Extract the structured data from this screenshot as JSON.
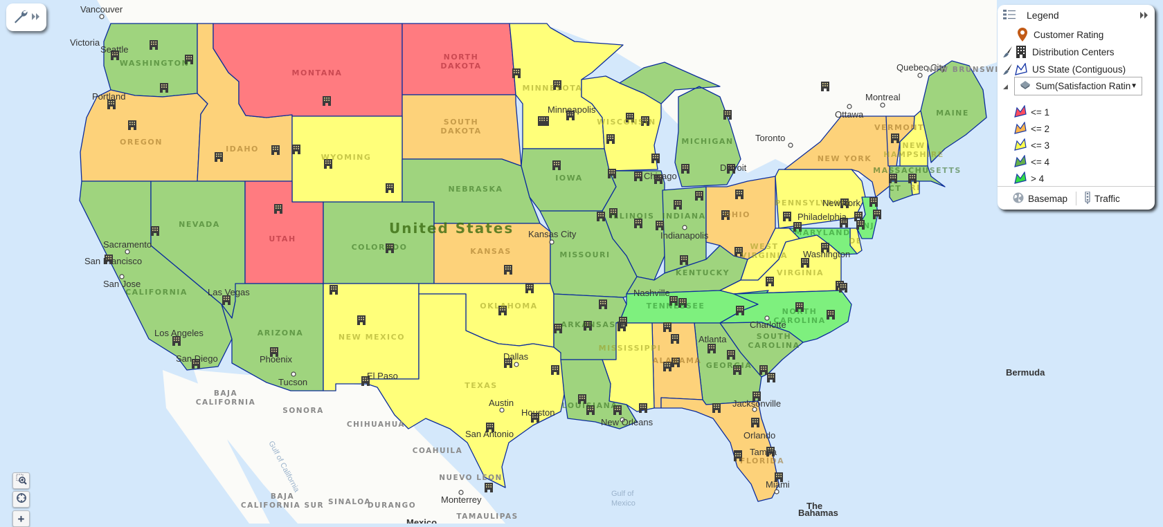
{
  "app": {
    "tool_button_label": "Tools"
  },
  "legend": {
    "title": "Legend",
    "collapse_icon": "double-chevron-right-icon",
    "layers": [
      {
        "name": "Customer Rating",
        "icon": "map-pin-icon",
        "editable": false
      },
      {
        "name": "Distribution Centers",
        "icon": "building-icon",
        "editable": true
      },
      {
        "name": "US State (Contiguous)",
        "icon": "polygon-icon",
        "editable": true
      }
    ],
    "theme_field": "Sum(Satisfaction Ratin",
    "classes": [
      {
        "label": "<= 1",
        "color": "#ff4d5e"
      },
      {
        "label": "<= 2",
        "color": "#ffb54a"
      },
      {
        "label": "<= 3",
        "color": "#ffff4d"
      },
      {
        "label": "<= 4",
        "color": "#66b04a"
      },
      {
        "label": "> 4",
        "color": "#33dd44"
      }
    ],
    "footer": {
      "basemap": "Basemap",
      "traffic": "Traffic"
    }
  },
  "map": {
    "country_label": "United States",
    "class_colors": {
      "c1": "#ff7b80",
      "c2": "#fdd27a",
      "c3": "#ffff7a",
      "c4": "#9fd47e",
      "c5": "#7ef07e"
    },
    "states": [
      {
        "name": "WASHINGTON",
        "class": "c4"
      },
      {
        "name": "OREGON",
        "class": "c2"
      },
      {
        "name": "IDAHO",
        "class": "c2"
      },
      {
        "name": "MONTANA",
        "class": "c1"
      },
      {
        "name": "NORTH DAKOTA",
        "class": "c1"
      },
      {
        "name": "SOUTH DAKOTA",
        "class": "c2"
      },
      {
        "name": "WYOMING",
        "class": "c3"
      },
      {
        "name": "MINNESOTA",
        "class": "c3"
      },
      {
        "name": "WISCONSIN",
        "class": "c3"
      },
      {
        "name": "MICHIGAN",
        "class": "c4"
      },
      {
        "name": "CALIFORNIA",
        "class": "c4"
      },
      {
        "name": "NEVADA",
        "class": "c4"
      },
      {
        "name": "UTAH",
        "class": "c1"
      },
      {
        "name": "COLORADO",
        "class": "c4"
      },
      {
        "name": "NEBRASKA",
        "class": "c4"
      },
      {
        "name": "IOWA",
        "class": "c4"
      },
      {
        "name": "ILLINOIS",
        "class": "c4"
      },
      {
        "name": "INDIANA",
        "class": "c4"
      },
      {
        "name": "OHIO",
        "class": "c2"
      },
      {
        "name": "PENNSYLVANIA",
        "class": "c3"
      },
      {
        "name": "NEW YORK",
        "class": "c2"
      },
      {
        "name": "VERMONT",
        "class": "c2"
      },
      {
        "name": "NEW HAMPSHIRE",
        "class": "c3"
      },
      {
        "name": "MAINE",
        "class": "c4"
      },
      {
        "name": "MASSACHUSETTS",
        "class": "c4"
      },
      {
        "name": "CT",
        "class": "c4"
      },
      {
        "name": "RI",
        "class": "c3"
      },
      {
        "name": "NJ",
        "class": "c5"
      },
      {
        "name": "DE",
        "class": "c3"
      },
      {
        "name": "MARYLAND",
        "class": "c5"
      },
      {
        "name": "ARIZONA",
        "class": "c4"
      },
      {
        "name": "NEW MEXICO",
        "class": "c3"
      },
      {
        "name": "KANSAS",
        "class": "c2"
      },
      {
        "name": "MISSOURI",
        "class": "c4"
      },
      {
        "name": "KENTUCKY",
        "class": "c4"
      },
      {
        "name": "WEST VIRGINIA",
        "class": "c3"
      },
      {
        "name": "VIRGINIA",
        "class": "c3"
      },
      {
        "name": "OKLAHOMA",
        "class": "c3"
      },
      {
        "name": "TEXAS",
        "class": "c3"
      },
      {
        "name": "ARKANSAS",
        "class": "c4"
      },
      {
        "name": "TENNESSEE",
        "class": "c5"
      },
      {
        "name": "NORTH CAROLINA",
        "class": "c5"
      },
      {
        "name": "SOUTH CAROLINA",
        "class": "c4"
      },
      {
        "name": "GEORGIA",
        "class": "c4"
      },
      {
        "name": "ALABAMA",
        "class": "c2"
      },
      {
        "name": "MISSISSIPPI",
        "class": "c3"
      },
      {
        "name": "LOUISIANA",
        "class": "c4"
      },
      {
        "name": "FLORIDA",
        "class": "c2"
      }
    ],
    "cities": [
      "Vancouver",
      "Victoria",
      "Seattle",
      "Portland",
      "Sacramento",
      "San Francisco",
      "San Jose",
      "Los Angeles",
      "San Diego",
      "Las Vegas",
      "Phoenix",
      "Tucson",
      "El Paso",
      "Minneapolis",
      "Chicago",
      "Detroit",
      "Kansas City",
      "Indianapolis",
      "Nashville",
      "Dallas",
      "Austin",
      "Houston",
      "San Antonio",
      "New Orleans",
      "Atlanta",
      "Charlotte",
      "Jacksonville",
      "Orlando",
      "Tampa",
      "Miami",
      "Washington",
      "Philadelphia",
      "New York",
      "Toronto",
      "Ottawa",
      "Montreal",
      "Quebec City",
      "Monterrey"
    ],
    "regions": [
      "BAJA CALIFORNIA",
      "SONORA",
      "CHIHUAHUA",
      "COAHUILA",
      "NUEVO LEON",
      "SINALOA",
      "DURANGO",
      "TAMAULIPAS",
      "BAJA CALIFORNIA SUR",
      "NEW BRUNSWICK"
    ],
    "places": {
      "bermuda": "Bermuda",
      "bahamas_1": "The",
      "bahamas_2": "Bahamas",
      "gulf_mexico_1": "Gulf of",
      "gulf_mexico_2": "Mexico",
      "gulf_california": "Gulf of California",
      "mexico": "Mexico"
    }
  },
  "controls": {
    "zoom_box": "zoom-box-icon",
    "locate": "locate-icon",
    "zoom_in": "+"
  }
}
